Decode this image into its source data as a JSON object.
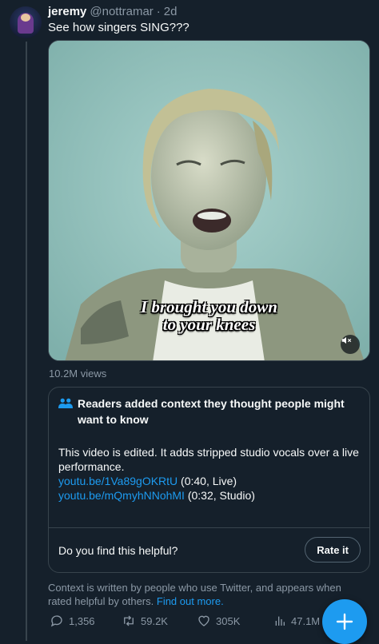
{
  "tweet": {
    "display_name": "jeremy",
    "handle": "@nottramar",
    "separator": "·",
    "time": "2d",
    "text": "See how singers SING???"
  },
  "media": {
    "caption_line1": "I brought you down",
    "caption_line2": "to your knees",
    "mute_icon": "volume-mute-icon",
    "views": "10.2M views"
  },
  "community_note": {
    "title": "Readers added context they thought people might want to know",
    "body": "This video is edited. It adds stripped studio vocals over a live performance.",
    "link1": "youtu.be/1Va89gOKRtU",
    "link1_note": " (0:40, Live)",
    "link2": "youtu.be/mQmyhNNohMI",
    "link2_note": " (0:32, Studio)",
    "helpful_question": "Do you find this helpful?",
    "rate_label": "Rate it"
  },
  "context": {
    "text": "Context is written by people who use Twitter, and appears when rated helpful by others.",
    "link": "Find out more."
  },
  "actions": {
    "replies": "1,356",
    "retweets": "59.2K",
    "likes": "305K",
    "views": "47.1M"
  },
  "colors": {
    "background": "#15202b",
    "accent": "#1d9bf0",
    "muted_text": "#8b98a5",
    "border": "#38444d"
  }
}
